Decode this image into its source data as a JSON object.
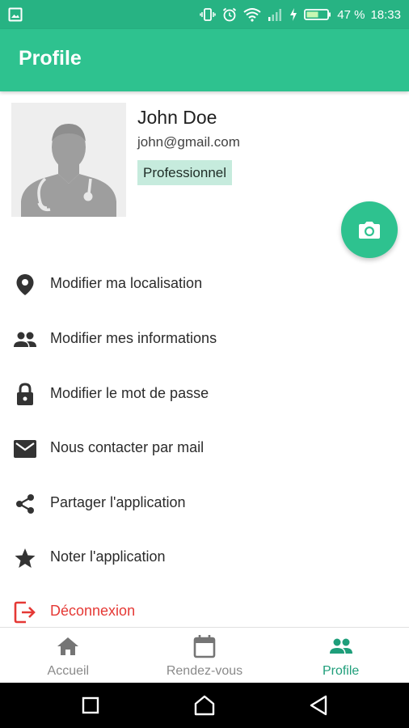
{
  "status_bar": {
    "battery_percent": "47 %",
    "time": "18:33",
    "icons": [
      "gallery-icon",
      "vibrate-icon",
      "alarm-icon",
      "wifi-icon",
      "signal-icon",
      "charging-icon",
      "battery-icon"
    ]
  },
  "app_bar": {
    "title": "Profile"
  },
  "profile": {
    "name": "John Doe",
    "email": "john@gmail.com",
    "role": "Professionnel",
    "avatar_icon": "doctor-avatar-icon",
    "camera_icon": "camera-icon"
  },
  "menu": {
    "items": [
      {
        "label": "Modifier ma localisation",
        "icon": "location-pin-icon"
      },
      {
        "label": "Modifier mes informations",
        "icon": "people-icon"
      },
      {
        "label": "Modifier le mot de passe",
        "icon": "lock-icon"
      },
      {
        "label": "Nous contacter par mail",
        "icon": "mail-icon"
      },
      {
        "label": "Partager l'application",
        "icon": "share-icon"
      },
      {
        "label": "Noter l'application",
        "icon": "star-icon"
      },
      {
        "label": "Déconnexion",
        "icon": "logout-icon"
      }
    ]
  },
  "bottom_nav": {
    "items": [
      {
        "label": "Accueil",
        "icon": "home-icon",
        "active": false
      },
      {
        "label": "Rendez-vous",
        "icon": "calendar-icon",
        "active": false
      },
      {
        "label": "Profile",
        "icon": "people-icon",
        "active": true
      }
    ]
  },
  "colors": {
    "primary": "#2ec28f",
    "status_bar": "#27b383",
    "badge_background": "#c6ebdd",
    "logout": "#e53935",
    "nav_active": "#1e9e7a",
    "nav_inactive": "#8a8a8a"
  }
}
